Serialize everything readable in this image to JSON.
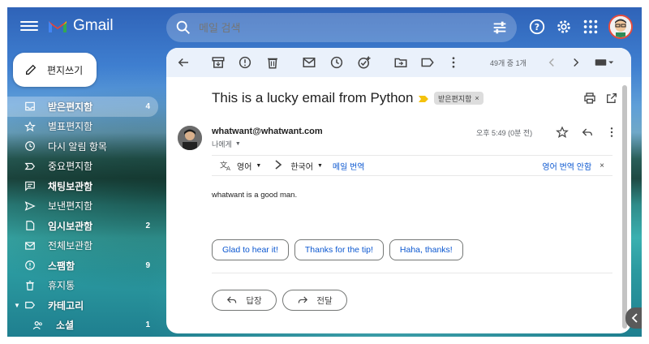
{
  "app": {
    "name": "Gmail"
  },
  "search": {
    "placeholder": "메일 검색"
  },
  "compose": {
    "label": "편지쓰기"
  },
  "sidebar": {
    "items": [
      {
        "label": "받은편지함",
        "count": "4",
        "icon": "inbox-icon"
      },
      {
        "label": "별표편지함",
        "count": "",
        "icon": "star-icon"
      },
      {
        "label": "다시 알림 항목",
        "count": "",
        "icon": "clock-icon"
      },
      {
        "label": "중요편지함",
        "count": "",
        "icon": "label-important-icon"
      },
      {
        "label": "채팅보관함",
        "count": "",
        "icon": "chat-icon"
      },
      {
        "label": "보낸편지함",
        "count": "",
        "icon": "send-icon"
      },
      {
        "label": "임시보관함",
        "count": "2",
        "icon": "draft-icon"
      },
      {
        "label": "전체보관함",
        "count": "",
        "icon": "mail-icon"
      },
      {
        "label": "스팸함",
        "count": "9",
        "icon": "report-icon"
      },
      {
        "label": "휴지통",
        "count": "",
        "icon": "trash-icon"
      },
      {
        "label": "카테고리",
        "count": "",
        "icon": "label-icon"
      },
      {
        "label": "소셜",
        "count": "1",
        "icon": "people-icon"
      }
    ]
  },
  "toolbar": {
    "pager": "49개 중 1개"
  },
  "email": {
    "subject": "This is a lucky email from Python",
    "label_chip": "받은편지함",
    "sender": "whatwant@whatwant.com",
    "to": "나에게",
    "time": "오후 5:49 (0분 전)",
    "body": "whatwant is a good man."
  },
  "translate": {
    "source_lang": "영어",
    "target_lang": "한국어",
    "translate_link": "메일 번역",
    "no_translate": "영어 번역 안함"
  },
  "smart_replies": [
    "Glad to hear it!",
    "Thanks for the tip!",
    "Haha, thanks!"
  ],
  "actions": {
    "reply": "답장",
    "forward": "전달"
  },
  "colors": {
    "accent": "#0b57d0",
    "toolbar_bg": "#eaf1fb",
    "important": "#f4c20d"
  }
}
